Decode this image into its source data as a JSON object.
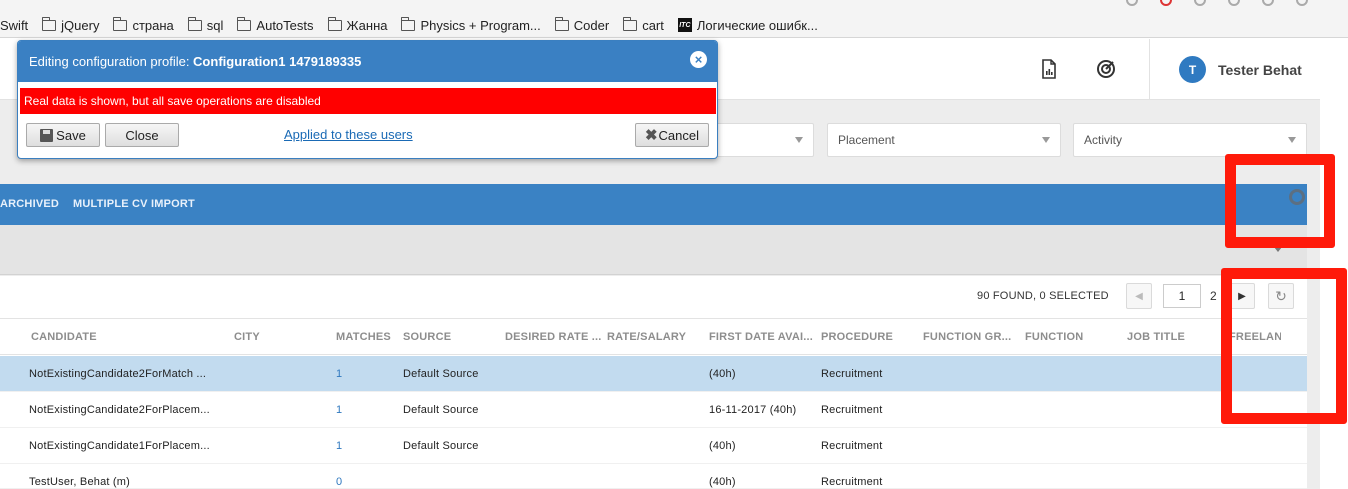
{
  "bookmarks": [
    {
      "label": "Swift",
      "icon": "none"
    },
    {
      "label": "jQuery",
      "icon": "folder-icon"
    },
    {
      "label": "страна",
      "icon": "folder-icon"
    },
    {
      "label": "sql",
      "icon": "folder-icon"
    },
    {
      "label": "AutoTests",
      "icon": "folder-icon"
    },
    {
      "label": "Жанна",
      "icon": "folder-icon"
    },
    {
      "label": "Physics + Program...",
      "icon": "folder-icon"
    },
    {
      "label": "Coder",
      "icon": "folder-icon"
    },
    {
      "label": "cart",
      "icon": "folder-icon"
    },
    {
      "label": "Логические ошибк...",
      "icon": "itc-icon"
    }
  ],
  "header": {
    "user_initial": "T",
    "user_name": "Tester Behat",
    "icons": [
      "report-icon",
      "target-icon"
    ]
  },
  "filters": {
    "placement": "Placement",
    "activity": "Activity"
  },
  "tabs": [
    "ARCHIVED",
    "MULTIPLE CV IMPORT"
  ],
  "results": {
    "found_text": "90 FOUND, 0 SELECTED",
    "page_value": "1",
    "next_page": "2"
  },
  "columns": [
    "CANDIDATE",
    "CITY",
    "MATCHES",
    "SOURCE",
    "DESIRED RATE ...",
    "RATE/SALARY",
    "FIRST DATE AVAI...",
    "PROCEDURE",
    "FUNCTION GR...",
    "FUNCTION",
    "JOB TITLE",
    "FREELANC"
  ],
  "rows": [
    {
      "candidate": "NotExistingCandidate2ForMatch ...",
      "matches": "1",
      "source": "Default Source",
      "first_date": "(40h)",
      "procedure": "Recruitment"
    },
    {
      "candidate": "NotExistingCandidate2ForPlacem...",
      "matches": "1",
      "source": "Default Source",
      "first_date": "16-11-2017 (40h)",
      "procedure": "Recruitment"
    },
    {
      "candidate": "NotExistingCandidate1ForPlacem...",
      "matches": "1",
      "source": "Default Source",
      "first_date": "(40h)",
      "procedure": "Recruitment"
    },
    {
      "candidate": "TestUser, Behat (m)",
      "matches": "0",
      "source": "",
      "first_date": "(40h)",
      "procedure": "Recruitment"
    }
  ],
  "modal": {
    "title_prefix": "Editing configuration profile: ",
    "title_name": "Configuration1 1479189335",
    "warning": "Real data is shown, but all save operations are disabled",
    "save_label": "Save",
    "close_label": "Close",
    "applied_link": "Applied to these users",
    "cancel_label": "Cancel"
  },
  "colors": {
    "primary_blue": "#3a82c4",
    "warning_red": "#ff0000",
    "selected_row": "#c2dbef",
    "annotation_red": "#ff1a0a"
  }
}
